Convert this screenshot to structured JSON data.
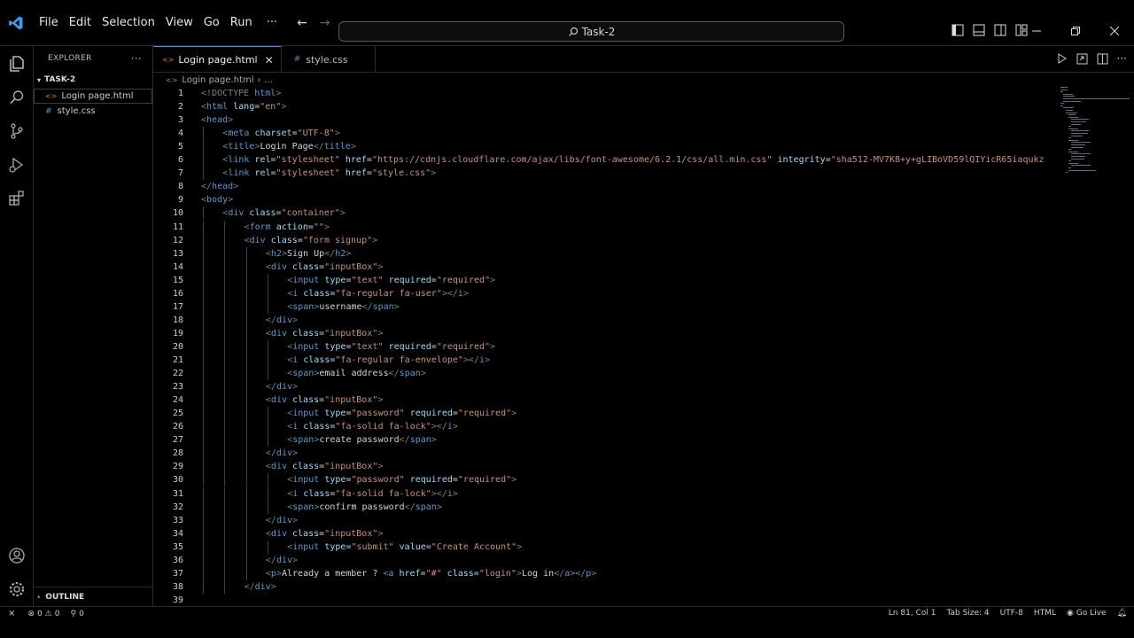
{
  "menu": [
    "File",
    "Edit",
    "Selection",
    "View",
    "Go",
    "Run"
  ],
  "menu_more": "···",
  "search": {
    "text": "Task-2"
  },
  "sidebar": {
    "title": "EXPLORER",
    "more": "···",
    "folder": "TASK-2",
    "files": [
      {
        "name": "Login page.html",
        "icon": "<>"
      },
      {
        "name": "style.css",
        "icon": "#"
      }
    ],
    "outline": "OUTLINE"
  },
  "tabs": [
    {
      "label": "Login page.html",
      "icon": "<>"
    },
    {
      "label": "style.css",
      "icon": "#"
    }
  ],
  "breadcrumb": {
    "file": "Login page.html",
    "sep": "›",
    "rest": "..."
  },
  "code_lines": [
    {
      "n": "1",
      "indent": 0,
      "segs": [
        [
          "t",
          "<!DOCTYPE "
        ],
        [
          "n",
          "html"
        ],
        [
          "t",
          ">"
        ]
      ]
    },
    {
      "n": "2",
      "indent": 0,
      "segs": [
        [
          "t",
          "<"
        ],
        [
          "n",
          "html "
        ],
        [
          "a",
          "lang"
        ],
        [
          "x",
          "="
        ],
        [
          "s",
          "\"en\""
        ],
        [
          "t",
          ">"
        ]
      ]
    },
    {
      "n": "3",
      "indent": 0,
      "segs": [
        [
          "t",
          "<"
        ],
        [
          "n",
          "head"
        ],
        [
          "t",
          ">"
        ]
      ]
    },
    {
      "n": "4",
      "indent": 1,
      "segs": [
        [
          "t",
          "<"
        ],
        [
          "n",
          "meta "
        ],
        [
          "a",
          "charset"
        ],
        [
          "x",
          "="
        ],
        [
          "s",
          "\"UTF-8\""
        ],
        [
          "t",
          ">"
        ]
      ]
    },
    {
      "n": "5",
      "indent": 1,
      "segs": [
        [
          "t",
          "<"
        ],
        [
          "n",
          "title"
        ],
        [
          "t",
          ">"
        ],
        [
          "x",
          "Login Page"
        ],
        [
          "t",
          "</"
        ],
        [
          "n",
          "title"
        ],
        [
          "t",
          ">"
        ]
      ]
    },
    {
      "n": "6",
      "indent": 1,
      "segs": [
        [
          "t",
          "<"
        ],
        [
          "n",
          "link "
        ],
        [
          "a",
          "rel"
        ],
        [
          "x",
          "="
        ],
        [
          "s",
          "\"stylesheet\" "
        ],
        [
          "a",
          "href"
        ],
        [
          "x",
          "="
        ],
        [
          "s",
          "\"https://cdnjs.cloudflare.com/ajax/libs/font-awesome/6.2.1/css/all.min.css\" "
        ],
        [
          "a",
          "integrity"
        ],
        [
          "x",
          "="
        ],
        [
          "s",
          "\"sha512-MV7K8+y+gLIBoVD59lQIYicR65iaqukz"
        ]
      ]
    },
    {
      "n": "7",
      "indent": 1,
      "segs": [
        [
          "t",
          "<"
        ],
        [
          "n",
          "link "
        ],
        [
          "a",
          "rel"
        ],
        [
          "x",
          "="
        ],
        [
          "s",
          "\"stylesheet\" "
        ],
        [
          "a",
          "href"
        ],
        [
          "x",
          "="
        ],
        [
          "s",
          "\"style.css\""
        ],
        [
          "t",
          ">"
        ]
      ]
    },
    {
      "n": "8",
      "indent": 0,
      "segs": [
        [
          "t",
          "</"
        ],
        [
          "n",
          "head"
        ],
        [
          "t",
          ">"
        ]
      ]
    },
    {
      "n": "9",
      "indent": 0,
      "segs": [
        [
          "t",
          "<"
        ],
        [
          "n",
          "body"
        ],
        [
          "t",
          ">"
        ]
      ]
    },
    {
      "n": "10",
      "indent": 1,
      "segs": [
        [
          "t",
          "<"
        ],
        [
          "n",
          "div "
        ],
        [
          "a",
          "class"
        ],
        [
          "x",
          "="
        ],
        [
          "s",
          "\"container\""
        ],
        [
          "t",
          ">"
        ]
      ]
    },
    {
      "n": "11",
      "indent": 2,
      "segs": [
        [
          "t",
          "<"
        ],
        [
          "n",
          "form "
        ],
        [
          "a",
          "action"
        ],
        [
          "x",
          "="
        ],
        [
          "s",
          "\"\""
        ],
        [
          "t",
          ">"
        ]
      ]
    },
    {
      "n": "12",
      "indent": 2,
      "segs": [
        [
          "t",
          "<"
        ],
        [
          "n",
          "div "
        ],
        [
          "a",
          "class"
        ],
        [
          "x",
          "="
        ],
        [
          "s",
          "\"form signup\""
        ],
        [
          "t",
          ">"
        ]
      ]
    },
    {
      "n": "13",
      "indent": 3,
      "segs": [
        [
          "t",
          "<"
        ],
        [
          "n",
          "h2"
        ],
        [
          "t",
          ">"
        ],
        [
          "x",
          "Sign Up"
        ],
        [
          "t",
          "</"
        ],
        [
          "n",
          "h2"
        ],
        [
          "t",
          ">"
        ]
      ]
    },
    {
      "n": "14",
      "indent": 3,
      "segs": [
        [
          "t",
          "<"
        ],
        [
          "n",
          "div "
        ],
        [
          "a",
          "class"
        ],
        [
          "x",
          "="
        ],
        [
          "s",
          "\"inputBox\""
        ],
        [
          "t",
          ">"
        ]
      ]
    },
    {
      "n": "15",
      "indent": 4,
      "segs": [
        [
          "t",
          "<"
        ],
        [
          "n",
          "input "
        ],
        [
          "a",
          "type"
        ],
        [
          "x",
          "="
        ],
        [
          "s",
          "\"text\" "
        ],
        [
          "a",
          "required"
        ],
        [
          "x",
          "="
        ],
        [
          "s",
          "\"required\""
        ],
        [
          "t",
          ">"
        ]
      ]
    },
    {
      "n": "16",
      "indent": 4,
      "segs": [
        [
          "t",
          "<"
        ],
        [
          "n",
          "i "
        ],
        [
          "a",
          "class"
        ],
        [
          "x",
          "="
        ],
        [
          "s",
          "\"fa-regular fa-user\""
        ],
        [
          "t",
          "></"
        ],
        [
          "n",
          "i"
        ],
        [
          "t",
          ">"
        ]
      ]
    },
    {
      "n": "17",
      "indent": 4,
      "segs": [
        [
          "t",
          "<"
        ],
        [
          "n",
          "span"
        ],
        [
          "t",
          ">"
        ],
        [
          "x",
          "username"
        ],
        [
          "t",
          "</"
        ],
        [
          "n",
          "span"
        ],
        [
          "t",
          ">"
        ]
      ]
    },
    {
      "n": "18",
      "indent": 3,
      "segs": [
        [
          "t",
          "</"
        ],
        [
          "n",
          "div"
        ],
        [
          "t",
          ">"
        ]
      ]
    },
    {
      "n": "19",
      "indent": 3,
      "segs": [
        [
          "t",
          "<"
        ],
        [
          "n",
          "div "
        ],
        [
          "a",
          "class"
        ],
        [
          "x",
          "="
        ],
        [
          "s",
          "\"inputBox\""
        ],
        [
          "t",
          ">"
        ]
      ]
    },
    {
      "n": "20",
      "indent": 4,
      "segs": [
        [
          "t",
          "<"
        ],
        [
          "n",
          "input "
        ],
        [
          "a",
          "type"
        ],
        [
          "x",
          "="
        ],
        [
          "s",
          "\"text\" "
        ],
        [
          "a",
          "required"
        ],
        [
          "x",
          "="
        ],
        [
          "s",
          "\"required\""
        ],
        [
          "t",
          ">"
        ]
      ]
    },
    {
      "n": "21",
      "indent": 4,
      "segs": [
        [
          "t",
          "<"
        ],
        [
          "n",
          "i "
        ],
        [
          "a",
          "class"
        ],
        [
          "x",
          "="
        ],
        [
          "s",
          "\"fa-regular fa-envelope\""
        ],
        [
          "t",
          "></"
        ],
        [
          "n",
          "i"
        ],
        [
          "t",
          ">"
        ]
      ]
    },
    {
      "n": "22",
      "indent": 4,
      "segs": [
        [
          "t",
          "<"
        ],
        [
          "n",
          "span"
        ],
        [
          "t",
          ">"
        ],
        [
          "x",
          "email address"
        ],
        [
          "t",
          "</"
        ],
        [
          "n",
          "span"
        ],
        [
          "t",
          ">"
        ]
      ]
    },
    {
      "n": "23",
      "indent": 3,
      "segs": [
        [
          "t",
          "</"
        ],
        [
          "n",
          "div"
        ],
        [
          "t",
          ">"
        ]
      ]
    },
    {
      "n": "24",
      "indent": 3,
      "segs": [
        [
          "t",
          "<"
        ],
        [
          "n",
          "div "
        ],
        [
          "a",
          "class"
        ],
        [
          "x",
          "="
        ],
        [
          "s",
          "\"inputBox\""
        ],
        [
          "t",
          ">"
        ]
      ]
    },
    {
      "n": "25",
      "indent": 4,
      "segs": [
        [
          "t",
          "<"
        ],
        [
          "n",
          "input "
        ],
        [
          "a",
          "type"
        ],
        [
          "x",
          "="
        ],
        [
          "s",
          "\"password\" "
        ],
        [
          "a",
          "required"
        ],
        [
          "x",
          "="
        ],
        [
          "s",
          "\"required\""
        ],
        [
          "t",
          ">"
        ]
      ]
    },
    {
      "n": "26",
      "indent": 4,
      "segs": [
        [
          "t",
          "<"
        ],
        [
          "n",
          "i "
        ],
        [
          "a",
          "class"
        ],
        [
          "x",
          "="
        ],
        [
          "s",
          "\"fa-solid fa-lock\""
        ],
        [
          "t",
          "></"
        ],
        [
          "n",
          "i"
        ],
        [
          "t",
          ">"
        ]
      ]
    },
    {
      "n": "27",
      "indent": 4,
      "segs": [
        [
          "t",
          "<"
        ],
        [
          "n",
          "span"
        ],
        [
          "t",
          ">"
        ],
        [
          "x",
          "create password"
        ],
        [
          "t",
          "</"
        ],
        [
          "n",
          "span"
        ],
        [
          "t",
          ">"
        ]
      ]
    },
    {
      "n": "28",
      "indent": 3,
      "segs": [
        [
          "t",
          "</"
        ],
        [
          "n",
          "div"
        ],
        [
          "t",
          ">"
        ]
      ]
    },
    {
      "n": "29",
      "indent": 3,
      "segs": [
        [
          "t",
          "<"
        ],
        [
          "n",
          "div "
        ],
        [
          "a",
          "class"
        ],
        [
          "x",
          "="
        ],
        [
          "s",
          "\"inputBox\""
        ],
        [
          "t",
          ">"
        ]
      ]
    },
    {
      "n": "30",
      "indent": 4,
      "segs": [
        [
          "t",
          "<"
        ],
        [
          "n",
          "input "
        ],
        [
          "a",
          "type"
        ],
        [
          "x",
          "="
        ],
        [
          "s",
          "\"password\" "
        ],
        [
          "a",
          "required"
        ],
        [
          "x",
          "="
        ],
        [
          "s",
          "\"required\""
        ],
        [
          "t",
          ">"
        ]
      ]
    },
    {
      "n": "31",
      "indent": 4,
      "segs": [
        [
          "t",
          "<"
        ],
        [
          "n",
          "i "
        ],
        [
          "a",
          "class"
        ],
        [
          "x",
          "="
        ],
        [
          "s",
          "\"fa-solid fa-lock\""
        ],
        [
          "t",
          "></"
        ],
        [
          "n",
          "i"
        ],
        [
          "t",
          ">"
        ]
      ]
    },
    {
      "n": "32",
      "indent": 4,
      "segs": [
        [
          "t",
          "<"
        ],
        [
          "n",
          "span"
        ],
        [
          "t",
          ">"
        ],
        [
          "x",
          "confirm password"
        ],
        [
          "t",
          "</"
        ],
        [
          "n",
          "span"
        ],
        [
          "t",
          ">"
        ]
      ]
    },
    {
      "n": "33",
      "indent": 3,
      "segs": [
        [
          "t",
          "</"
        ],
        [
          "n",
          "div"
        ],
        [
          "t",
          ">"
        ]
      ]
    },
    {
      "n": "34",
      "indent": 3,
      "segs": [
        [
          "t",
          "<"
        ],
        [
          "n",
          "div "
        ],
        [
          "a",
          "class"
        ],
        [
          "x",
          "="
        ],
        [
          "s",
          "\"inputBox\""
        ],
        [
          "t",
          ">"
        ]
      ]
    },
    {
      "n": "35",
      "indent": 4,
      "segs": [
        [
          "t",
          "<"
        ],
        [
          "n",
          "input "
        ],
        [
          "a",
          "type"
        ],
        [
          "x",
          "="
        ],
        [
          "s",
          "\"submit\" "
        ],
        [
          "a",
          "value"
        ],
        [
          "x",
          "="
        ],
        [
          "s",
          "\"Create Account\""
        ],
        [
          "t",
          ">"
        ]
      ]
    },
    {
      "n": "36",
      "indent": 3,
      "segs": [
        [
          "t",
          "</"
        ],
        [
          "n",
          "div"
        ],
        [
          "t",
          ">"
        ]
      ]
    },
    {
      "n": "37",
      "indent": 3,
      "segs": [
        [
          "t",
          "<"
        ],
        [
          "n",
          "p"
        ],
        [
          "t",
          ">"
        ],
        [
          "x",
          "Already a member ? "
        ],
        [
          "t",
          "<"
        ],
        [
          "n",
          "a "
        ],
        [
          "a",
          "href"
        ],
        [
          "x",
          "="
        ],
        [
          "s",
          "\"#\" "
        ],
        [
          "a",
          "class"
        ],
        [
          "x",
          "="
        ],
        [
          "s",
          "\"login\""
        ],
        [
          "t",
          ">"
        ],
        [
          "x",
          "Log in"
        ],
        [
          "t",
          "</"
        ],
        [
          "n",
          "a"
        ],
        [
          "t",
          "></"
        ],
        [
          "n",
          "p"
        ],
        [
          "t",
          ">"
        ]
      ]
    },
    {
      "n": "38",
      "indent": 2,
      "segs": [
        [
          "t",
          "</"
        ],
        [
          "n",
          "div"
        ],
        [
          "t",
          ">"
        ]
      ]
    },
    {
      "n": "39",
      "indent": 0,
      "segs": []
    }
  ],
  "status": {
    "errors": "0",
    "warnings": "0",
    "ports": "0",
    "position": "Ln 81, Col 1",
    "tab_size": "Tab Size: 4",
    "encoding": "UTF-8",
    "language": "HTML",
    "golive": "Go Live"
  },
  "colors": {
    "accent": "#3794ff",
    "tag": "#569cd6",
    "attr": "#9cdcfe",
    "string": "#ce9178"
  }
}
